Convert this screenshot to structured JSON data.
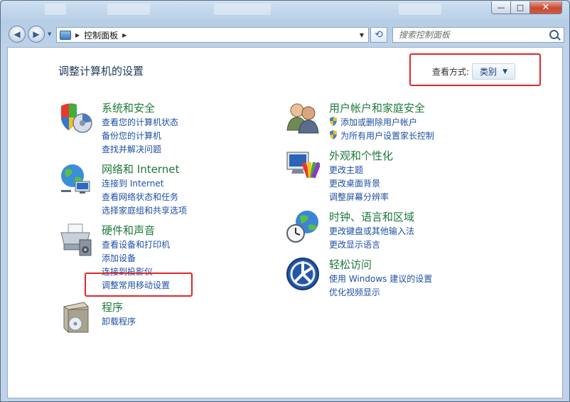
{
  "address": {
    "path": "控制面板",
    "search_placeholder": "搜索控制面板"
  },
  "main": {
    "title": "调整计算机的设置",
    "view_by_label": "查看方式:",
    "view_by_value": "类别"
  },
  "left_categories": [
    {
      "title": "系统和安全",
      "icon": "system-security-icon",
      "links": [
        "查看您的计算机状态",
        "备份您的计算机",
        "查找并解决问题"
      ]
    },
    {
      "title": "网络和 Internet",
      "icon": "network-globe-icon",
      "links": [
        "连接到 Internet",
        "查看网络状态和任务",
        "选择家庭组和共享选项"
      ]
    },
    {
      "title": "硬件和声音",
      "icon": "printer-hardware-icon",
      "links": [
        "查看设备和打印机",
        "添加设备",
        "连接到投影仪",
        "调整常用移动设置"
      ]
    },
    {
      "title": "程序",
      "icon": "programs-box-icon",
      "links": [
        "卸载程序"
      ]
    }
  ],
  "right_categories": [
    {
      "title": "用户帐户和家庭安全",
      "icon": "users-icon",
      "links": [
        "添加或删除用户帐户",
        "为所有用户设置家长控制"
      ],
      "shield_links": true
    },
    {
      "title": "外观和个性化",
      "icon": "monitor-palette-icon",
      "links": [
        "更改主题",
        "更改桌面背景",
        "调整屏幕分辨率"
      ]
    },
    {
      "title": "时钟、语言和区域",
      "icon": "clock-globe-icon",
      "links": [
        "更改键盘或其他输入法",
        "更改显示语言"
      ]
    },
    {
      "title": "轻松访问",
      "icon": "ease-of-access-icon",
      "links": [
        "使用 Windows 建议的设置",
        "优化视频显示"
      ]
    }
  ],
  "window_controls": {
    "minimize": "—",
    "maximize": "□",
    "close": "✕"
  },
  "nav": {
    "back": "◀",
    "forward": "▶",
    "dropdown": "▼",
    "refresh": "⟲"
  },
  "colors": {
    "category_title": "#1d7a3a",
    "link": "#1d4fa6",
    "highlight": "#e0272a"
  }
}
